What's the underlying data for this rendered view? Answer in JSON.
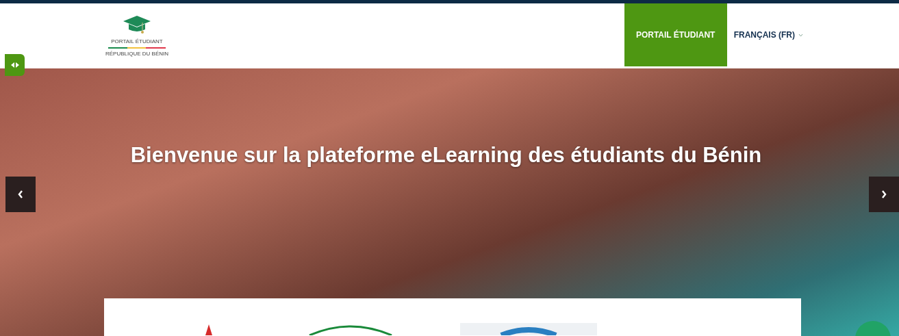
{
  "logo": {
    "title": "PORTAIL ÉTUDIANT",
    "subtitle": "RÉPUBLIQUE DU BÉNIN"
  },
  "nav": [
    {
      "label": "PORTAIL ÉTUDIANT",
      "selected": true,
      "kind": "link"
    },
    {
      "label": "FRANÇAIS (FR)",
      "selected": false,
      "kind": "dropdown"
    }
  ],
  "hero": {
    "caption": "Bienvenue sur la plateforme eLearning des étudiants du Bénin"
  }
}
